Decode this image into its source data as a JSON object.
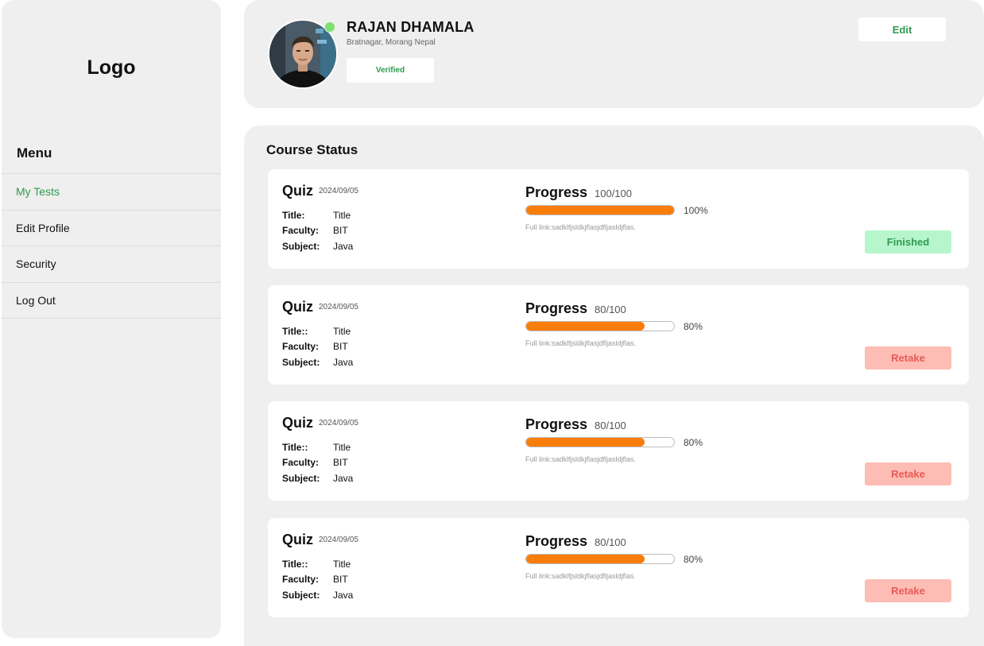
{
  "sidebar": {
    "logo": "Logo",
    "menu_title": "Menu",
    "items": [
      {
        "label": "My Tests",
        "active": true
      },
      {
        "label": "Edit Profile",
        "active": false
      },
      {
        "label": "Security",
        "active": false
      },
      {
        "label": "Log Out",
        "active": false
      }
    ]
  },
  "profile": {
    "name": "RAJAN DHAMALA",
    "location": "Bratnagar, Morang Nepal",
    "verified_label": "Verified",
    "edit_label": "Edit",
    "online": true
  },
  "course_status": {
    "title": "Course Status",
    "cards": [
      {
        "quiz_label": "Quiz",
        "date": "2024/09/05",
        "title_key": "Title:",
        "title_val": "Title",
        "faculty_key": "Faculty:",
        "faculty_val": "BIT",
        "subject_key": "Subject:",
        "subject_val": "Java",
        "progress_label": "Progress",
        "score": "100/100",
        "progress": 1.0,
        "percent": "100%",
        "full_link": "Full link:sadklfjsldkjflasjdfljasldjflas.",
        "action": "Finished",
        "action_type": "finished"
      },
      {
        "quiz_label": "Quiz",
        "date": "2024/09/05",
        "title_key": "Title::",
        "title_val": "Title",
        "faculty_key": "Faculty:",
        "faculty_val": "BIT",
        "subject_key": "Subject:",
        "subject_val": "Java",
        "progress_label": "Progress",
        "score": "80/100",
        "progress": 0.8,
        "percent": "80%",
        "full_link": "Full link:sadklfjsldkjflasjdfljasldjflas.",
        "action": "Retake",
        "action_type": "retake"
      },
      {
        "quiz_label": "Quiz",
        "date": "2024/09/05",
        "title_key": "Title::",
        "title_val": "Title",
        "faculty_key": "Faculty:",
        "faculty_val": "BIT",
        "subject_key": "Subject:",
        "subject_val": "Java",
        "progress_label": "Progress",
        "score": "80/100",
        "progress": 0.8,
        "percent": "80%",
        "full_link": "Full link:sadklfjsldkjflasjdfljasldjflas.",
        "action": "Retake",
        "action_type": "retake"
      },
      {
        "quiz_label": "Quiz",
        "date": "2024/09/05",
        "title_key": "Title::",
        "title_val": "Title",
        "faculty_key": "Faculty:",
        "faculty_val": "BIT",
        "subject_key": "Subject:",
        "subject_val": "Java",
        "progress_label": "Progress",
        "score": "80/100",
        "progress": 0.8,
        "percent": "80%",
        "full_link": "Full link:sadklfjsldkjflasjdfljasldjflas.",
        "action": "Retake",
        "action_type": "retake"
      }
    ]
  },
  "colors": {
    "accent_green": "#2e9a4e",
    "progress_orange": "#f97d0b",
    "finished_bg": "#b7f6cd",
    "retake_bg": "#fdbcb4",
    "online_green": "#7ee06f"
  },
  "icons": {
    "avatar": "user-avatar-photo",
    "online_indicator": "online-status-dot"
  }
}
